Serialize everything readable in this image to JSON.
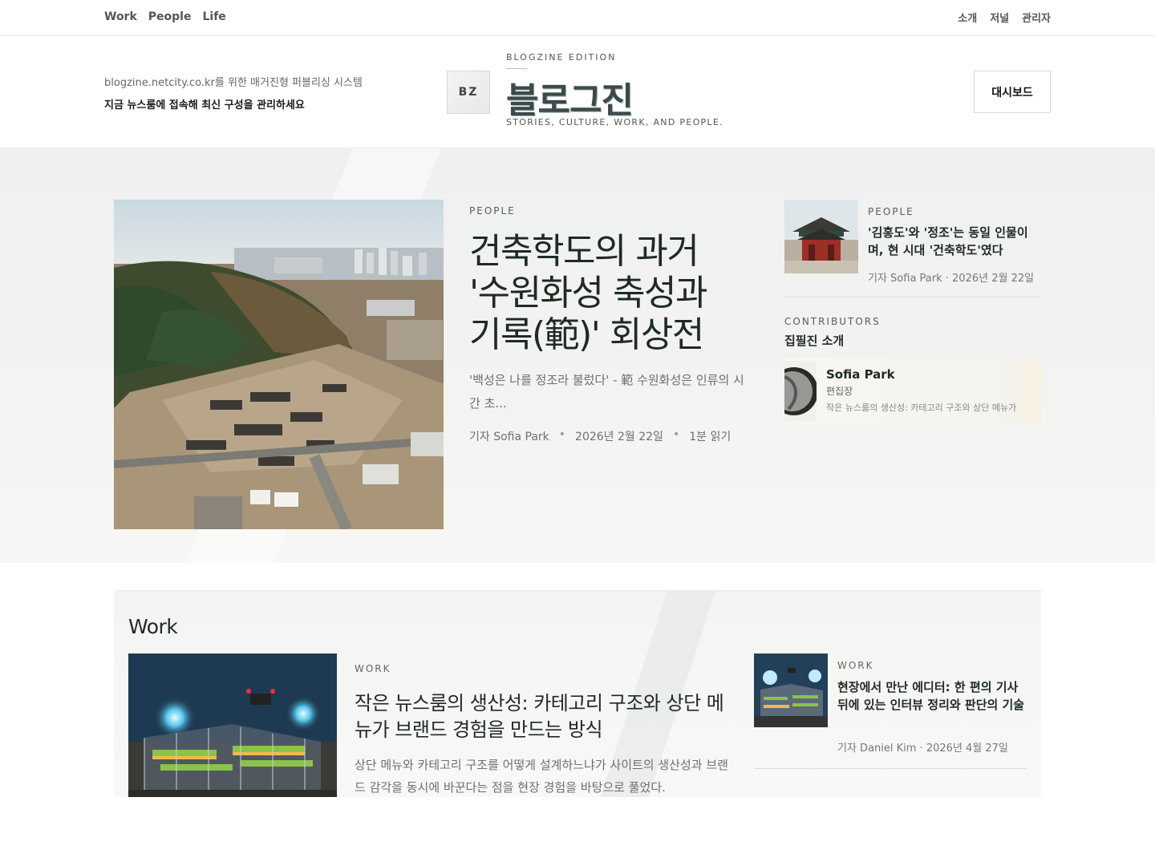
{
  "topnav": {
    "left": [
      "Work",
      "People",
      "Life"
    ],
    "right": [
      "소개",
      "저널",
      "관리자"
    ]
  },
  "masthead": {
    "tagline": "blogzine.netcity.co.kr를 위한 매거진형 퍼블리싱 시스템",
    "subtagline": "지금 뉴스룸에 접속해 최신 구성을 관리하세요",
    "logo_mark": "BZ",
    "edition": "BLOGZINE EDITION",
    "brand": "블로그진",
    "brand_sub": "STORIES, CULTURE, WORK, AND PEOPLE.",
    "dashboard_label": "대시보드"
  },
  "hero": {
    "category": "PEOPLE",
    "title": "건축학도의 과거 '수원화성 축성과 기록(範)' 회상전",
    "excerpt": "'백성은 나를 정조라 불렀다' - 範 수원화성은 인류의 시간 초...",
    "author": "기자 Sofia Park",
    "date": "2026년 2월 22일",
    "read_time": "1분 읽기"
  },
  "side_story": {
    "category": "PEOPLE",
    "title": "'김홍도'와 '정조'는 동일 인물이며, 현 시대 '건축학도'였다",
    "meta": "기자 Sofia Park · 2026년 2월 22일"
  },
  "contributors": {
    "kicker": "CONTRIBUTORS",
    "title": "집필진 소개",
    "name": "Sofia Park",
    "role": "편집장",
    "bio": "작은 뉴스룸의 생산성: 카테고리 구조와 상단 메뉴가"
  },
  "work_section": {
    "heading": "Work",
    "main": {
      "category": "WORK",
      "title": "작은 뉴스룸의 생산성: 카테고리 구조와 상단 메뉴가 브랜드 경험을 만드는 방식",
      "excerpt": "상단 메뉴와 카테고리 구조를 어떻게 설계하느냐가 사이트의 생산성과 브랜드 감각을 동시에 바꾼다는 점을 현장 경험을 바탕으로 풀었다."
    },
    "side": {
      "category": "WORK",
      "title": "현장에서 만난 에디터: 한 편의 기사 뒤에 있는 인터뷰 정리와 판단의 기술",
      "meta": "기자 Daniel Kim · 2026년 4월 27일"
    }
  }
}
